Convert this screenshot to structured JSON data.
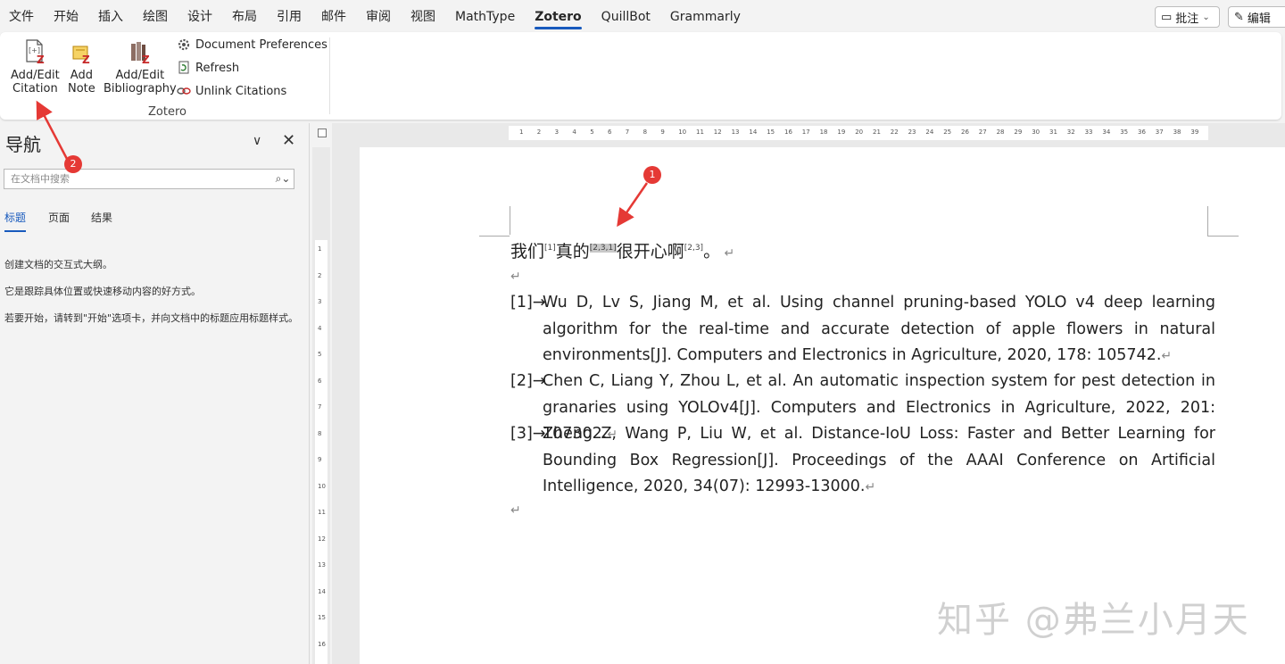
{
  "menu": {
    "tabs": [
      "文件",
      "开始",
      "插入",
      "绘图",
      "设计",
      "布局",
      "引用",
      "邮件",
      "审阅",
      "视图",
      "MathType",
      "Zotero",
      "QuillBot",
      "Grammarly"
    ],
    "active": "Zotero",
    "comment_label": "批注",
    "edit_label": "编辑"
  },
  "ribbon": {
    "add_citation": [
      "Add/Edit",
      "Citation"
    ],
    "add_note": [
      "Add",
      "Note"
    ],
    "add_bibliography": [
      "Add/Edit",
      "Bibliography"
    ],
    "doc_prefs": "Document Preferences",
    "refresh": "Refresh",
    "unlink": "Unlink Citations",
    "group_label": "Zotero"
  },
  "nav": {
    "title": "导航",
    "search_placeholder": "在文档中搜索",
    "tabs": [
      "标题",
      "页面",
      "结果"
    ],
    "text1": "创建文档的交互式大纲。",
    "text2": "它是跟踪具体位置或快速移动内容的好方式。",
    "text3": "若要开始，请转到\"开始\"选项卡，并向文档中的标题应用标题样式。"
  },
  "doc": {
    "cn_a": "我们",
    "sup1": "[1]",
    "cn_b": "真的",
    "sup2": "[2,3,1]",
    "cn_c": "很开心啊",
    "sup3": "[2,3]",
    "cn_d": "。",
    "refs": [
      {
        "num": "[1]→",
        "text": "Wu D, Lv S, Jiang M, et al. Using channel pruning-based YOLO v4 deep learning algorithm for the real-time and accurate detection of apple flowers in natural environments[J]. Computers and Electronics in Agriculture, 2020, 178: 105742."
      },
      {
        "num": "[2]→",
        "text": "Chen C, Liang Y, Zhou L, et al. An automatic inspection system for pest detection in granaries using YOLOv4[J]. Computers and Electronics in Agriculture, 2022, 201: 107302."
      },
      {
        "num": "[3]→",
        "text": "Zheng Z, Wang P, Liu W, et al. Distance-IoU Loss: Faster and Better Learning for Bounding Box Regression[J]. Proceedings of the AAAI Conference on Artificial Intelligence, 2020, 34(07): 12993-13000."
      }
    ]
  },
  "watermark": "知乎 @弗兰小月天",
  "annotations": {
    "badge1": "1",
    "badge2": "2"
  },
  "colors": {
    "accent": "#185abd",
    "annotation": "#e53935"
  }
}
